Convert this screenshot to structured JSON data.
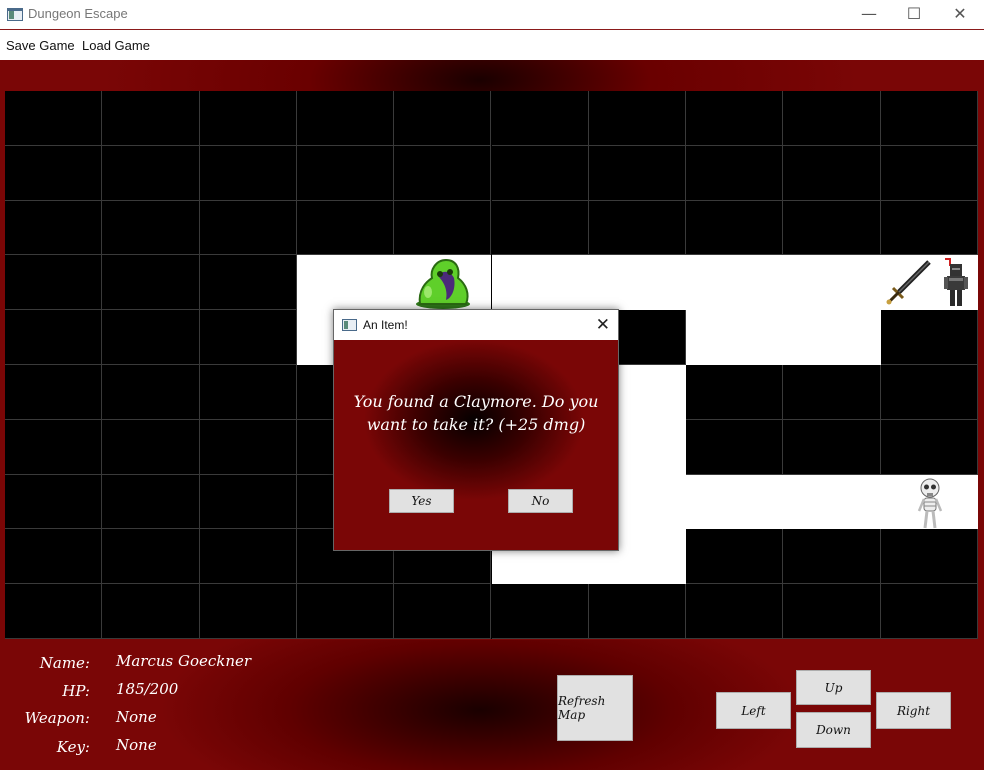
{
  "window": {
    "title": "Dungeon Escape",
    "minimize": "—",
    "maximize": "☐",
    "close": "✕"
  },
  "menu": {
    "save_game": "Save Game",
    "load_game": "Load Game"
  },
  "map": {
    "cols": 10,
    "rows": 10,
    "floor_cells": [
      [
        3,
        3
      ],
      [
        3,
        4
      ],
      [
        3,
        5
      ],
      [
        3,
        6
      ],
      [
        3,
        7
      ],
      [
        3,
        8
      ],
      [
        3,
        9
      ],
      [
        4,
        3
      ],
      [
        4,
        7
      ],
      [
        4,
        8
      ],
      [
        5,
        6
      ],
      [
        6,
        6
      ],
      [
        7,
        5
      ],
      [
        7,
        6
      ],
      [
        7,
        7
      ],
      [
        7,
        8
      ],
      [
        7,
        9
      ],
      [
        8,
        5
      ],
      [
        8,
        6
      ]
    ],
    "sprites": {
      "slime": "slime-monster",
      "sword": "claymore-sword",
      "knight": "player-knight",
      "skeleton": "skeleton-enemy"
    }
  },
  "player": {
    "name_label": "Name:",
    "name": "Marcus Goeckner",
    "hp_label": "HP:",
    "hp": "185/200",
    "weapon_label": "Weapon:",
    "weapon": "None",
    "key_label": "Key:",
    "key": "None"
  },
  "controls": {
    "refresh": "Refresh Map",
    "up": "Up",
    "down": "Down",
    "left": "Left",
    "right": "Right"
  },
  "dialog": {
    "title": "An Item!",
    "message": "You found a Claymore. Do you want to take it? (+25 dmg)",
    "yes": "Yes",
    "no": "No"
  }
}
